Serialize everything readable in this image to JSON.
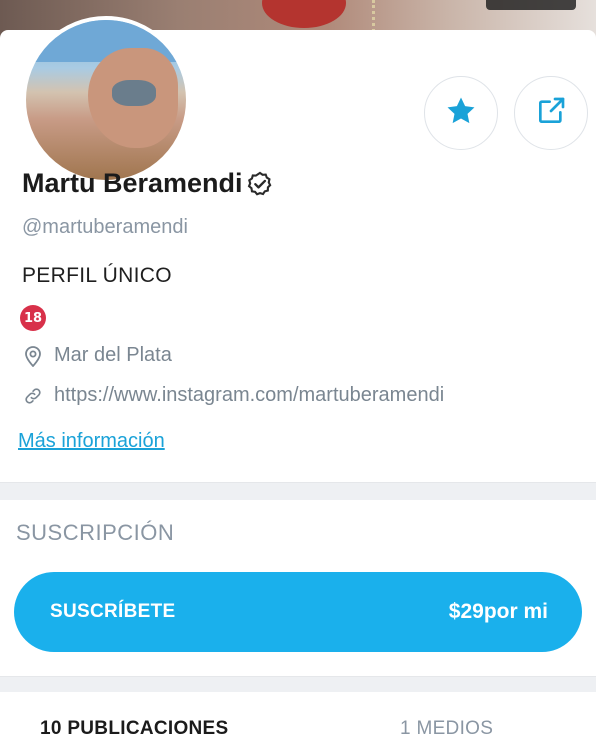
{
  "profile": {
    "name": "Martu Beramendi",
    "handle": "@martuberamendi",
    "bio": "PERFIL ÚNICO",
    "age_badge": "18",
    "location": "Mar del Plata",
    "website": "https://www.instagram.com/martuberamendi",
    "more_info": "Más información"
  },
  "subscription": {
    "title": "SUSCRIPCIÓN",
    "button_label": "SUSCRÍBETE",
    "price": "$29por mi"
  },
  "tabs": {
    "posts": "10 PUBLICACIONES",
    "media": "1 MEDIOS"
  },
  "colors": {
    "accent": "#1ab0ec",
    "muted_text": "#8a96a3",
    "badge": "#d8314a"
  }
}
